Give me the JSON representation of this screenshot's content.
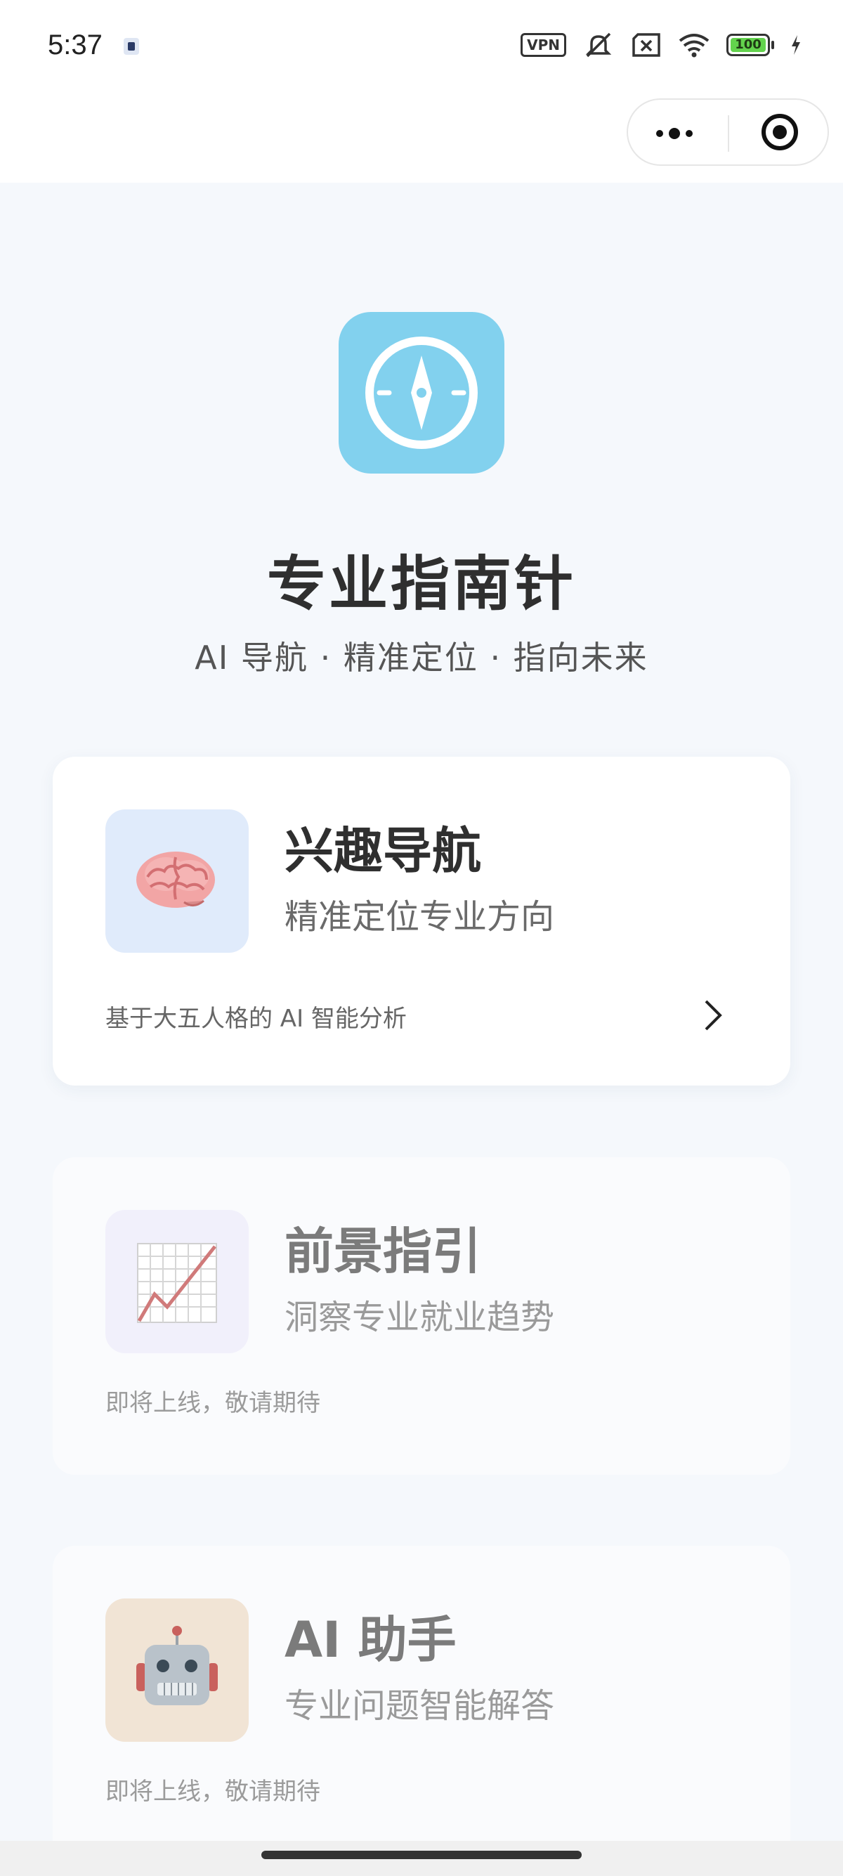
{
  "status_bar": {
    "time": "5:37",
    "vpn_label": "VPN",
    "battery_level": "100",
    "icons": [
      "app-notification-icon",
      "vpn-icon",
      "mute-icon",
      "sim-off-icon",
      "wifi-icon",
      "battery-icon",
      "charging-icon"
    ]
  },
  "capsule": {
    "more_label": "more-options-icon",
    "close_label": "close-miniprogram-icon"
  },
  "header": {
    "title": "专业指南针",
    "subtitle": "AI 导航 · 精准定位 · 指向未来"
  },
  "cards": [
    {
      "title": "兴趣导航",
      "subtitle": "精准定位专业方向",
      "note": "基于大五人格的 AI 智能分析",
      "icon": "brain-icon",
      "icon_bg": "#e0ebfb",
      "enabled": true
    },
    {
      "title": "前景指引",
      "subtitle": "洞察专业就业趋势",
      "note": "即将上线，敬请期待",
      "icon": "chart-increasing-icon",
      "icon_bg": "#f1f0fb",
      "enabled": false
    },
    {
      "title": "AI 助手",
      "subtitle": "专业问题智能解答",
      "note": "即将上线，敬请期待",
      "icon": "robot-icon",
      "icon_bg": "#f1e4d5",
      "enabled": false
    }
  ],
  "colors": {
    "accent": "#82d1ee",
    "background": "#f5f8fc"
  }
}
